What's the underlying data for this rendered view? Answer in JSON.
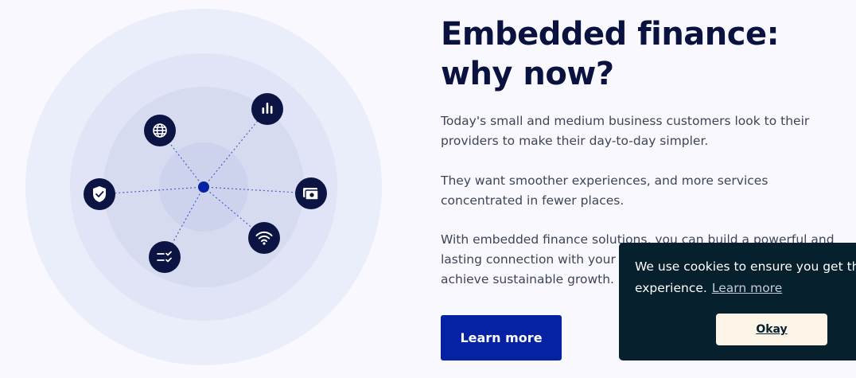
{
  "hero": {
    "title": "Embedded finance: why now?",
    "paragraphs": [
      "Today's small and medium business customers look to their providers to make their day-to-day simpler.",
      "They want smoother experiences, and more services concentrated in fewer places.",
      "With embedded finance solutions, you can build a powerful and lasting connection with your business customers and help them achieve sustainable growth."
    ],
    "cta_label": "Learn more"
  },
  "illustration": {
    "icons": [
      "globe-icon",
      "bar-chart-icon",
      "shield-check-icon",
      "cash-icon",
      "wifi-icon",
      "checklist-icon"
    ],
    "colors": {
      "ring_outer": "#eaedfa",
      "ring_middle": "#e0e4f6",
      "ring_inner": "#d6dbf0",
      "ring_core": "#cdd3ec",
      "icon_bg": "#0b1442",
      "center_dot": "#0522a4"
    }
  },
  "cookie": {
    "message_line1": "We use cookies to ensure you get the best",
    "message_line2": "experience.",
    "learn_more": "Learn more",
    "ok_label": "Okay"
  },
  "colors": {
    "background": "#f8f8fe",
    "heading": "#0a1240",
    "body_text": "#3e4556",
    "accent": "#0522a4",
    "cookie_bg": "#07202e",
    "cookie_button": "#fdf4e8"
  }
}
